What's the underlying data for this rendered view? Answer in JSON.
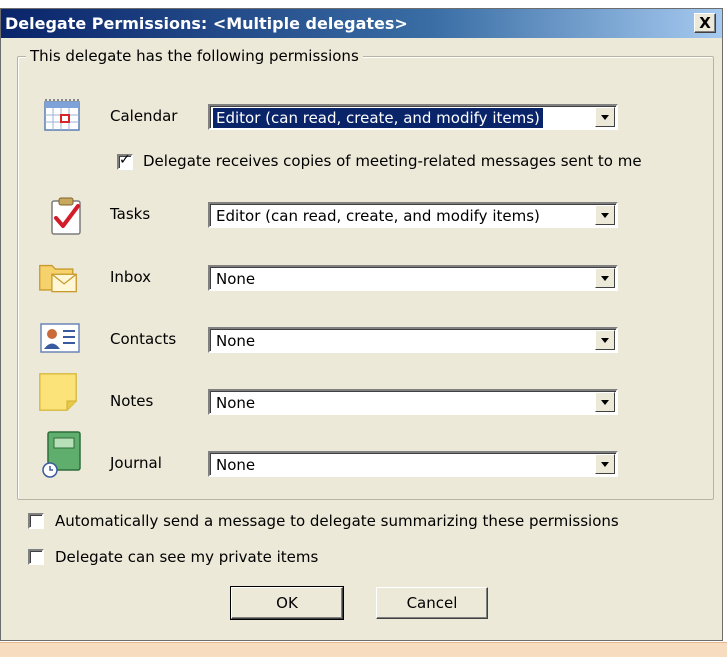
{
  "dialog": {
    "title": "Delegate Permissions: <Multiple delegates>",
    "close_label": "X"
  },
  "group": {
    "legend": "This delegate has the following permissions"
  },
  "permissions": [
    {
      "key": "calendar",
      "label": "Calendar",
      "value": "Editor (can read, create, and modify items)",
      "icon": "calendar-icon"
    },
    {
      "key": "tasks",
      "label": "Tasks",
      "value": "Editor (can read, create, and modify items)",
      "icon": "tasks-icon"
    },
    {
      "key": "inbox",
      "label": "Inbox",
      "value": "None",
      "icon": "inbox-icon"
    },
    {
      "key": "contacts",
      "label": "Contacts",
      "value": "None",
      "icon": "contacts-icon"
    },
    {
      "key": "notes",
      "label": "Notes",
      "value": "None",
      "icon": "notes-icon"
    },
    {
      "key": "journal",
      "label": "Journal",
      "value": "None",
      "icon": "journal-icon"
    }
  ],
  "calendar_option": {
    "label": "Delegate receives copies of meeting-related messages sent to me",
    "checked": true
  },
  "options": {
    "auto_send": {
      "label": "Automatically send a message to delegate summarizing these permissions",
      "checked": false
    },
    "private_items": {
      "label": "Delegate can see my private items",
      "checked": false
    }
  },
  "buttons": {
    "ok": "OK",
    "cancel": "Cancel"
  }
}
